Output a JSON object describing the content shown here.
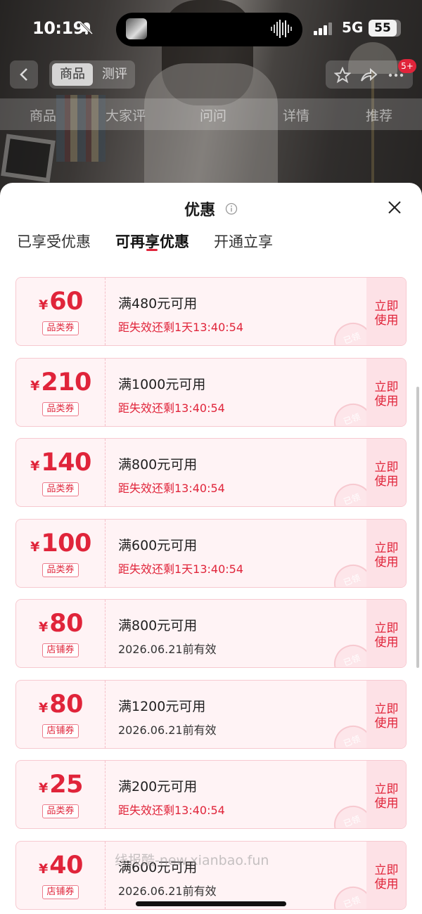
{
  "status_bar": {
    "time": "10:19",
    "network": "5G",
    "battery": "55"
  },
  "top_nav": {
    "tab_product": "商品",
    "tab_review": "测评",
    "cart_badge": "5+"
  },
  "sub_nav": {
    "items": [
      "商品",
      "大家评",
      "问问",
      "详情",
      "推荐"
    ]
  },
  "sheet": {
    "title": "优惠",
    "tabs": [
      {
        "label": "已享受优惠",
        "active": false
      },
      {
        "label": "可再享优惠",
        "active": true
      },
      {
        "label": "开通立享",
        "active": false
      }
    ]
  },
  "coupons": [
    {
      "currency": "¥",
      "amount": "60",
      "type": "品类券",
      "condition": "满480元可用",
      "expiry": "距失效还剩1天13:40:54",
      "expiry_style": "red",
      "action": "立即使用",
      "stamp": "已领"
    },
    {
      "currency": "¥",
      "amount": "210",
      "type": "品类券",
      "condition": "满1000元可用",
      "expiry": "距失效还剩13:40:54",
      "expiry_style": "red",
      "action": "立即使用",
      "stamp": "已领"
    },
    {
      "currency": "¥",
      "amount": "140",
      "type": "品类券",
      "condition": "满800元可用",
      "expiry": "距失效还剩13:40:54",
      "expiry_style": "red",
      "action": "立即使用",
      "stamp": "已领"
    },
    {
      "currency": "¥",
      "amount": "100",
      "type": "品类券",
      "condition": "满600元可用",
      "expiry": "距失效还剩1天13:40:54",
      "expiry_style": "red",
      "action": "立即使用",
      "stamp": "已领"
    },
    {
      "currency": "¥",
      "amount": "80",
      "type": "店铺券",
      "condition": "满800元可用",
      "expiry": "2026.06.21前有效",
      "expiry_style": "plain",
      "action": "立即使用",
      "stamp": "已领"
    },
    {
      "currency": "¥",
      "amount": "80",
      "type": "店铺券",
      "condition": "满1200元可用",
      "expiry": "2026.06.21前有效",
      "expiry_style": "plain",
      "action": "立即使用",
      "stamp": "已领"
    },
    {
      "currency": "¥",
      "amount": "25",
      "type": "品类券",
      "condition": "满200元可用",
      "expiry": "距失效还剩13:40:54",
      "expiry_style": "red",
      "action": "立即使用",
      "stamp": "已领"
    },
    {
      "currency": "¥",
      "amount": "40",
      "type": "店铺券",
      "condition": "满600元可用",
      "expiry": "2026.06.21前有效",
      "expiry_style": "plain",
      "action": "立即使用",
      "stamp": "已领"
    }
  ],
  "watermark": "线报酷-new.xianbao.fun",
  "colors": {
    "accent": "#e0243a",
    "coupon_bg": "#fff3f5",
    "coupon_border": "#f7c9d0",
    "action_bg": "#fde1e6"
  }
}
